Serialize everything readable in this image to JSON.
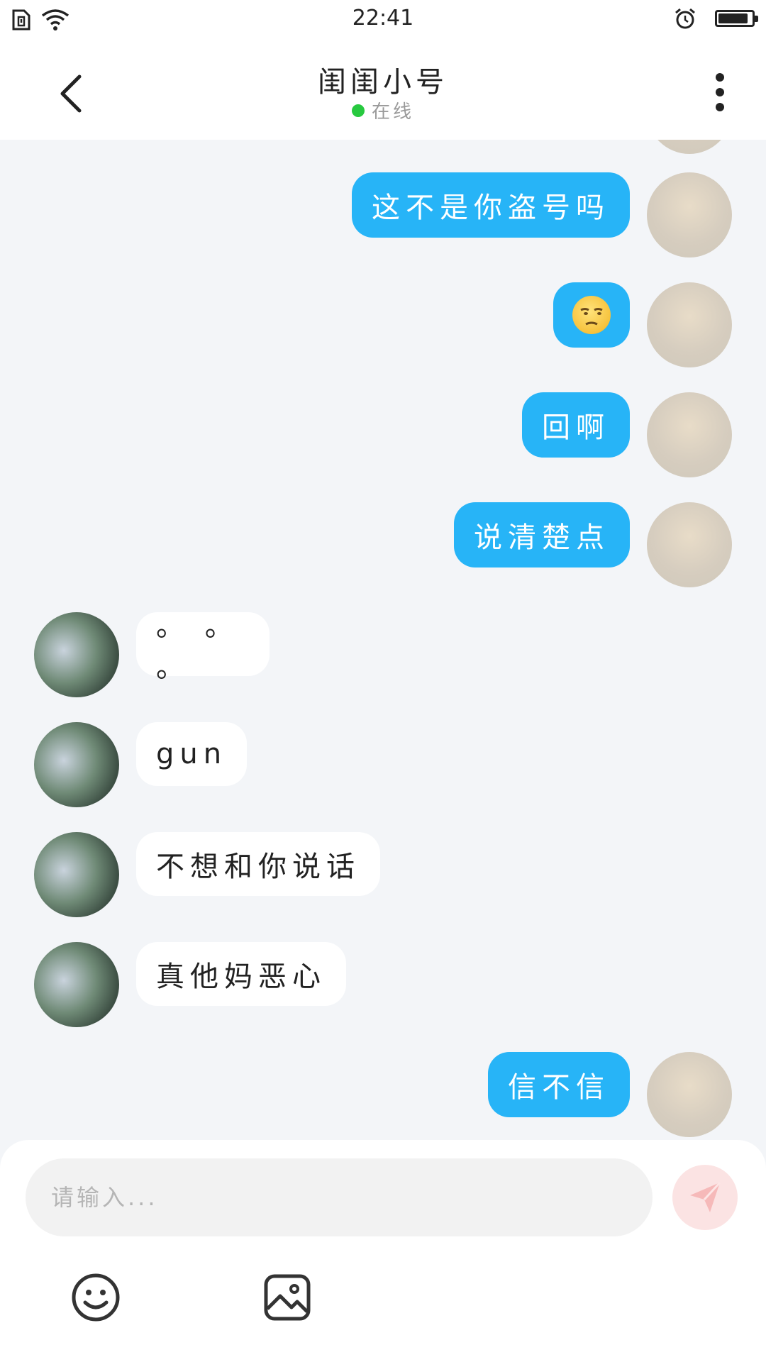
{
  "status_bar": {
    "time": "22:41",
    "icons": [
      "sim-icon",
      "wifi-icon",
      "alarm-icon",
      "battery-icon"
    ],
    "battery_level": 0.9
  },
  "header": {
    "title": "闺闺小号",
    "status": "在线",
    "status_color": "#27c93f",
    "back_icon": "chevron-left-icon",
    "more_icon": "more-vertical-icon"
  },
  "messages": [
    {
      "side": "me",
      "text": "这不是你盗号吗"
    },
    {
      "side": "me",
      "text": "😒",
      "type": "emoji"
    },
    {
      "side": "me",
      "text": "回啊"
    },
    {
      "side": "me",
      "text": "说清楚点"
    },
    {
      "side": "other",
      "text": "。 。 。"
    },
    {
      "side": "other",
      "text": "gun"
    },
    {
      "side": "other",
      "text": "不想和你说话"
    },
    {
      "side": "other",
      "text": "真他妈恶心"
    },
    {
      "side": "me",
      "text": "信不信"
    }
  ],
  "composer": {
    "placeholder": "请输入...",
    "send_icon": "send-icon",
    "emoji_icon": "smiley-icon",
    "image_icon": "image-icon"
  },
  "colors": {
    "my_bubble": "#27b4f7",
    "other_bubble": "#ffffff",
    "background": "#f3f5f8"
  }
}
